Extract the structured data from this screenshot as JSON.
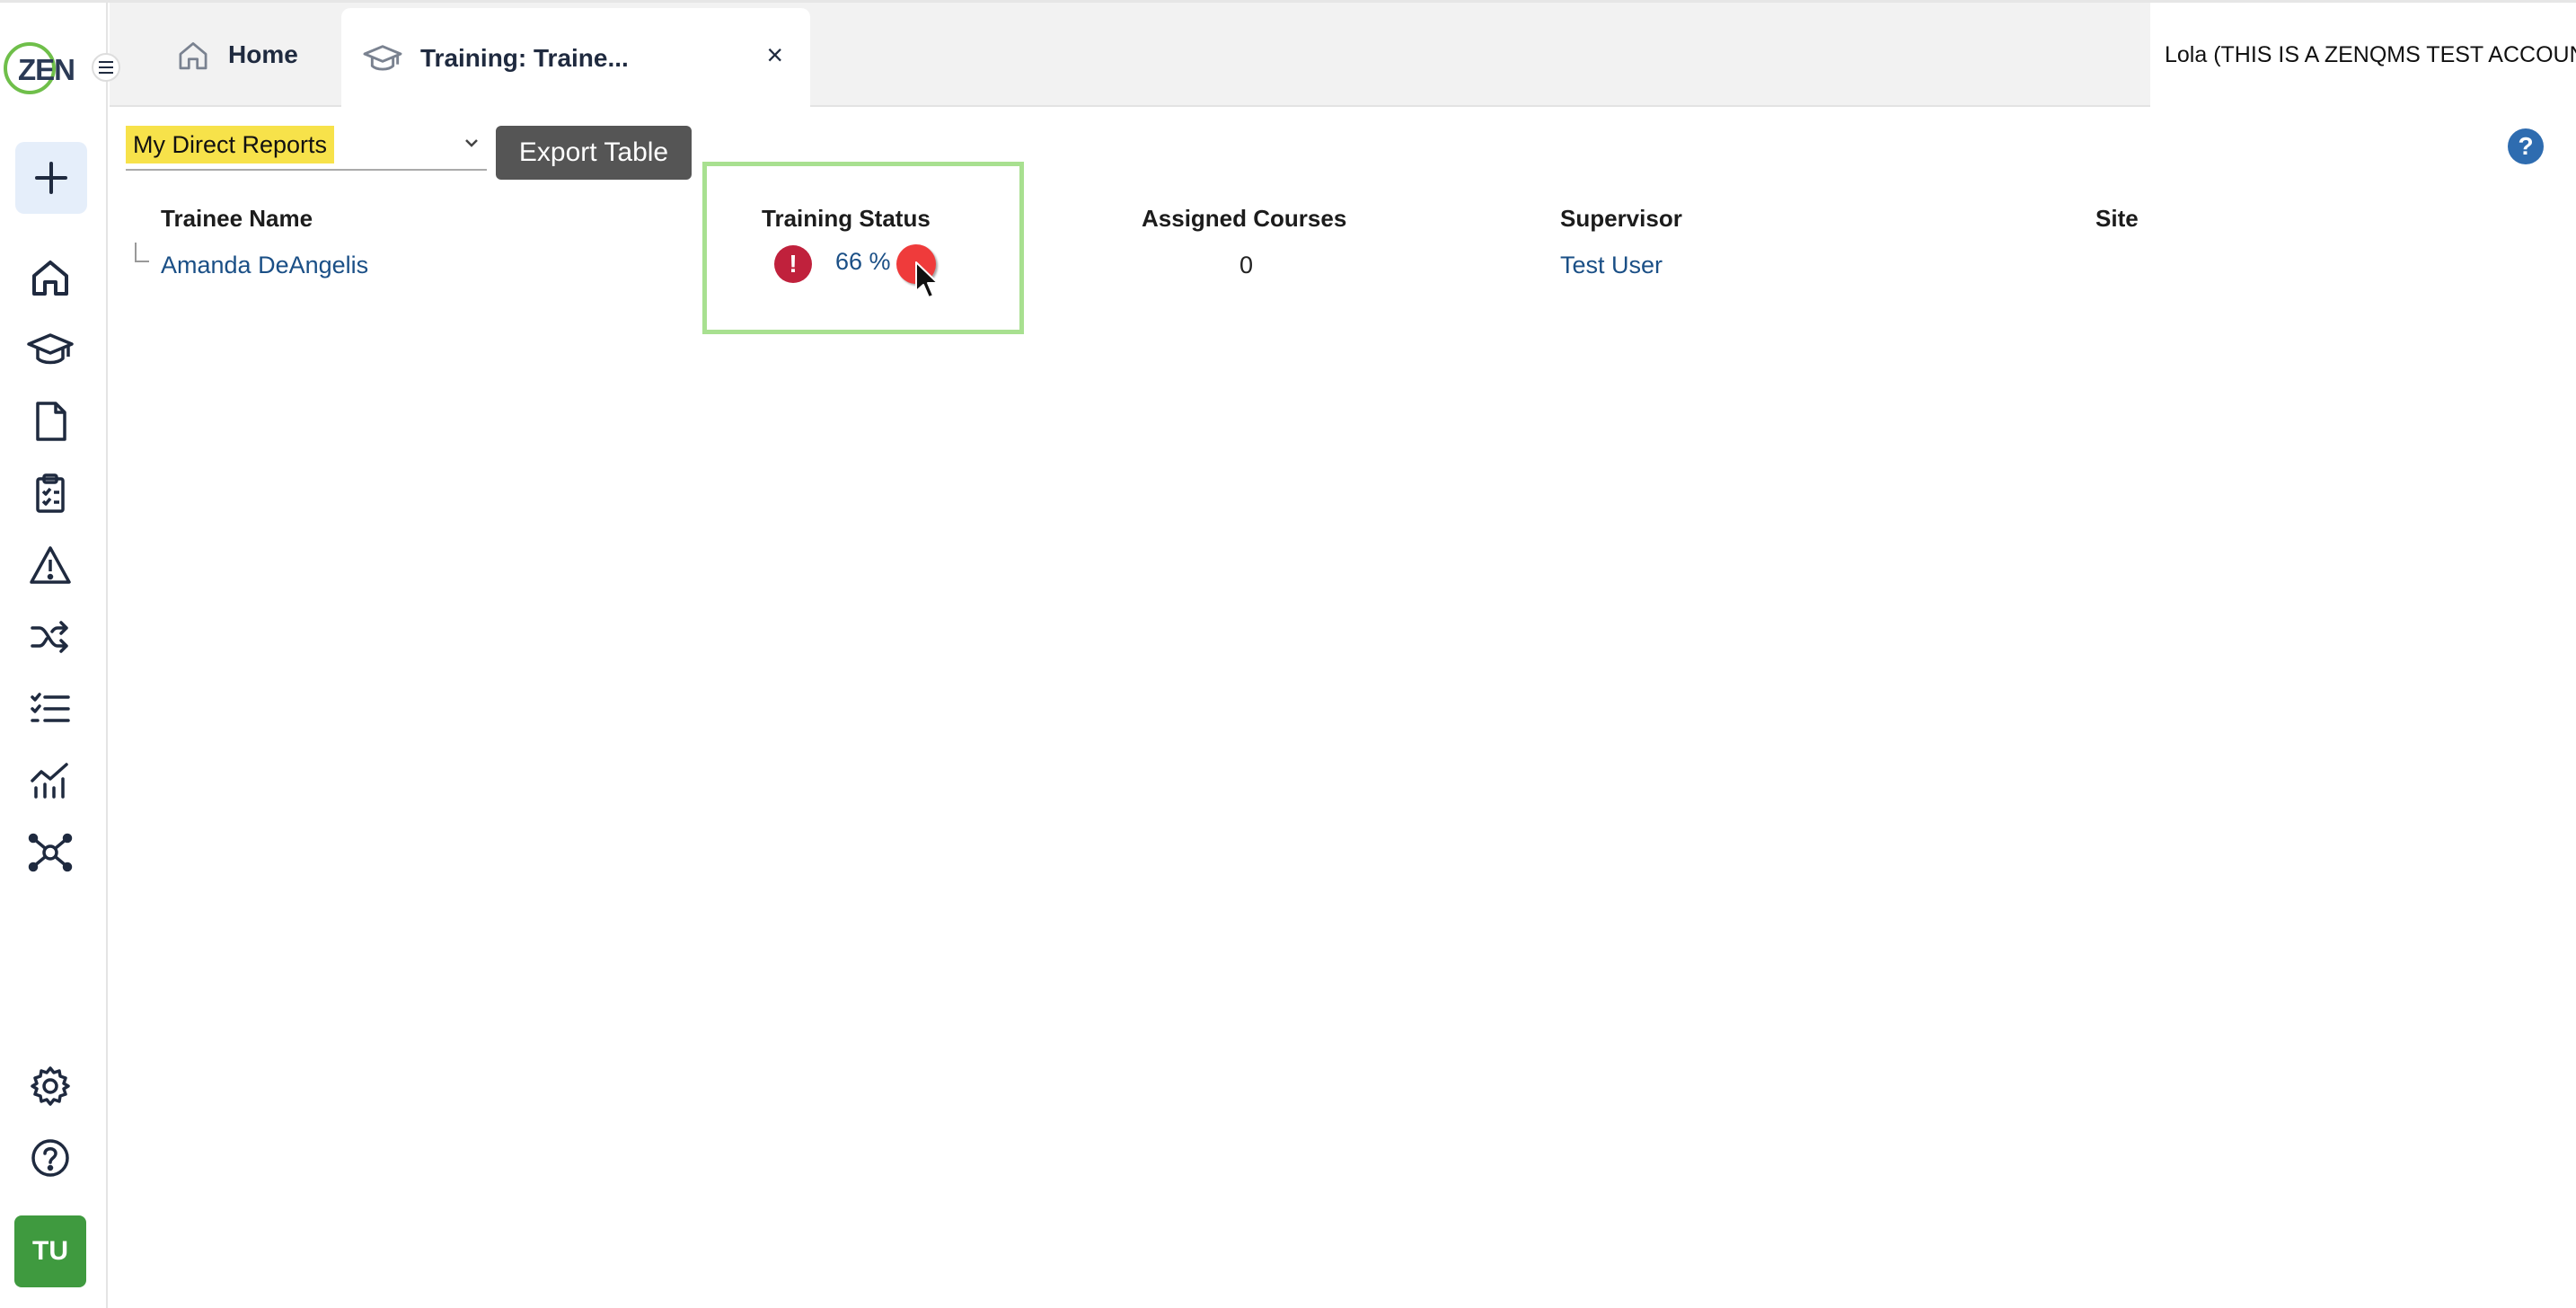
{
  "app": {
    "logo_text": "ZEN"
  },
  "tabs": [
    {
      "label": "Home",
      "icon": "home-icon"
    },
    {
      "label": "Training: Traine...",
      "icon": "graduation-cap-icon",
      "close": "×",
      "active": true
    }
  ],
  "user": {
    "label": "Lola (THIS IS A ZENQMS TEST ACCOUNT)"
  },
  "sidebar": {
    "items": [
      {
        "name": "add",
        "icon": "plus-icon"
      },
      {
        "name": "home",
        "icon": "home-icon"
      },
      {
        "name": "training",
        "icon": "graduation-cap-icon"
      },
      {
        "name": "documents",
        "icon": "document-icon"
      },
      {
        "name": "checklist",
        "icon": "clipboard-icon"
      },
      {
        "name": "issues",
        "icon": "warning-icon"
      },
      {
        "name": "change-control",
        "icon": "shuffle-icon"
      },
      {
        "name": "lists",
        "icon": "checklist-icon"
      },
      {
        "name": "reports",
        "icon": "chart-icon"
      },
      {
        "name": "network",
        "icon": "network-icon"
      },
      {
        "name": "settings",
        "icon": "gear-icon"
      },
      {
        "name": "help",
        "icon": "help-icon"
      }
    ],
    "avatar_initials": "TU"
  },
  "toolbar": {
    "filter_value": "My Direct Reports",
    "export_label": "Export Table",
    "help": "?"
  },
  "table": {
    "headers": {
      "trainee_name": "Trainee Name",
      "training_status": "Training Status",
      "assigned_courses": "Assigned Courses",
      "supervisor": "Supervisor",
      "site": "Site"
    },
    "rows": [
      {
        "trainee_name": "Amanda DeAngelis",
        "status_icon": "!",
        "training_status": "66 %",
        "assigned_courses": "0",
        "supervisor": "Test User",
        "site": ""
      }
    ]
  },
  "colors": {
    "accent": "#2e6cb0",
    "highlight": "#f7e24a",
    "status_alert": "#c0213c",
    "box_outline": "#a8e090"
  }
}
